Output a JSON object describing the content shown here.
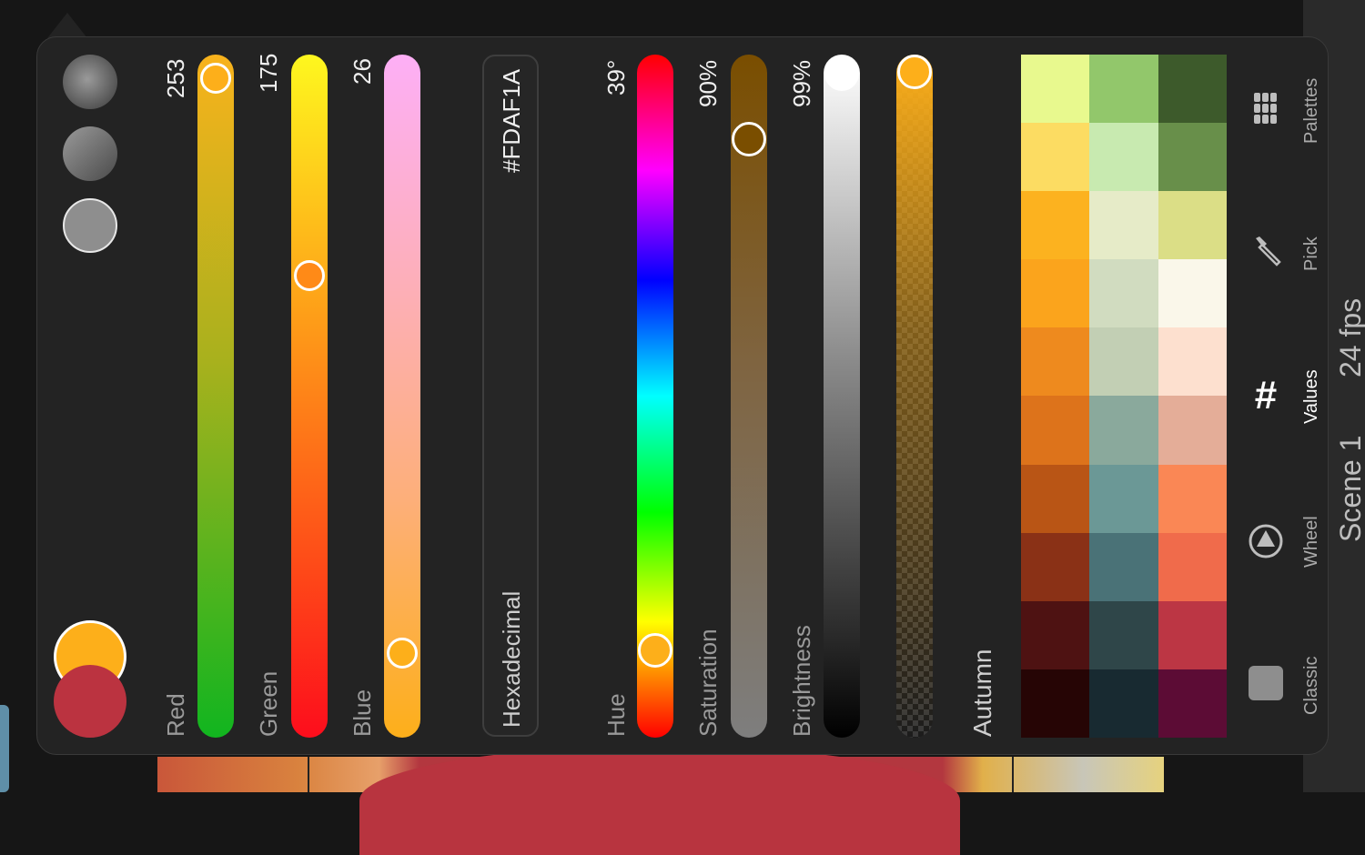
{
  "sliders": {
    "red": {
      "label": "Red",
      "value": "253",
      "level": 0.992
    },
    "green": {
      "label": "Green",
      "value": "175",
      "level": 0.686
    },
    "blue": {
      "label": "Blue",
      "value": "26",
      "level": 0.102
    }
  },
  "hex": {
    "label": "Hexadecimal",
    "value": "#FDAF1A"
  },
  "hsb": {
    "hue": {
      "label": "Hue",
      "value": "39°"
    },
    "saturation": {
      "label": "Saturation",
      "value": "90%"
    },
    "brightness": {
      "label": "Brightness",
      "value": "99%"
    }
  },
  "opacity": {
    "level": 1.0
  },
  "palette": {
    "name": "Autumn",
    "colors": [
      "#e8f98e",
      "#92c76b",
      "#3d5a2b",
      "#fcdc62",
      "#c8eab0",
      "#688f4a",
      "#fcb21f",
      "#e6ebc8",
      "#dbde86",
      "#fba41c",
      "#d1dcc0",
      "#faf7ea",
      "#ee8a1e",
      "#c2cfb4",
      "#fde0cf",
      "#dd731b",
      "#8aa99c",
      "#e4ad98",
      "#b95515",
      "#6b9896",
      "#fa8755",
      "#8a3116",
      "#4a7277",
      "#f06b4b",
      "#4e1212",
      "#2f4649",
      "#bc3644",
      "#260505",
      "#182a31",
      "#5c0c35"
    ]
  },
  "colors": {
    "primary": "#fdaf1a",
    "secondary": "#bb3340"
  },
  "tabs": [
    {
      "label": "Palettes",
      "icon": "palettes-grid-icon",
      "active": false
    },
    {
      "label": "Pick",
      "icon": "eyedropper-icon",
      "active": false
    },
    {
      "label": "Values",
      "icon": "hash-icon",
      "active": true
    },
    {
      "label": "Wheel",
      "icon": "wheel-icon",
      "active": false
    },
    {
      "label": "Classic",
      "icon": "classic-square-icon",
      "active": false
    }
  ],
  "side": {
    "fps": "24 fps",
    "scene": "Scene 1"
  }
}
